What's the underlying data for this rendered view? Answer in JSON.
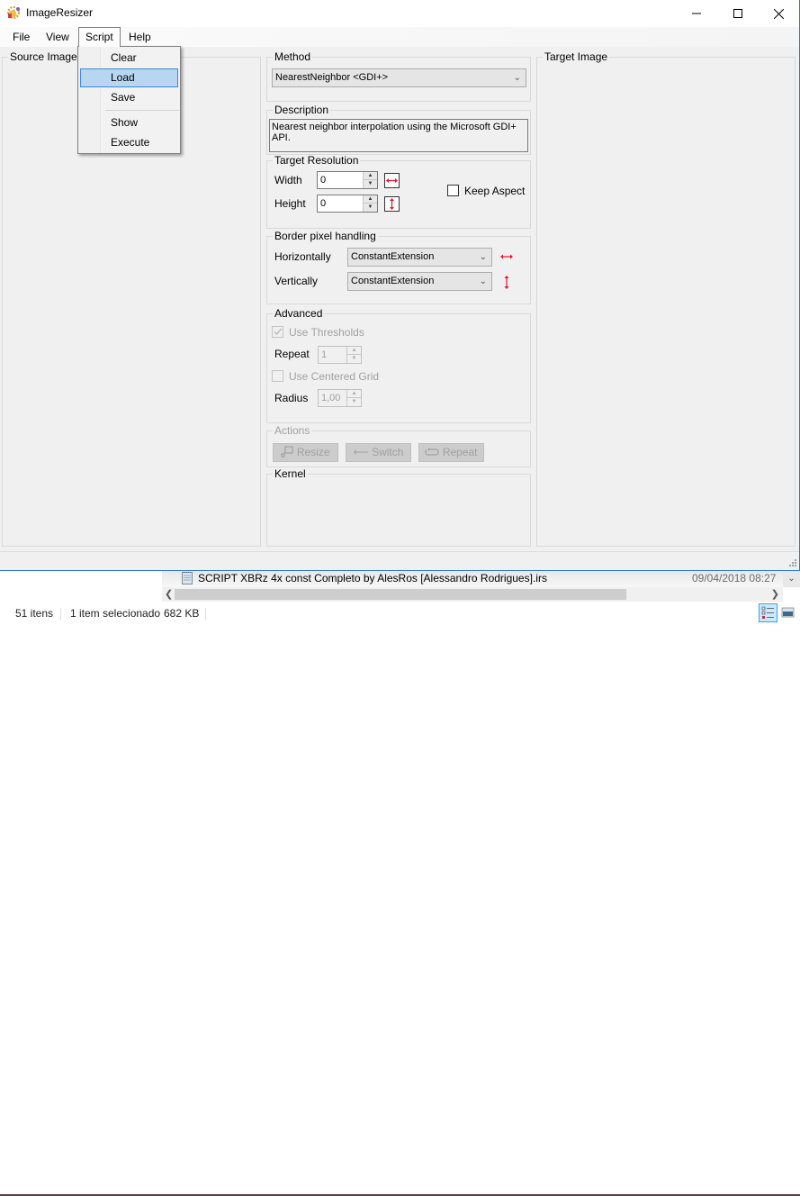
{
  "window": {
    "title": "ImageResizer",
    "controls": [
      "minimize",
      "maximize",
      "close"
    ]
  },
  "menubar": {
    "items": [
      {
        "label": "File"
      },
      {
        "label": "View"
      },
      {
        "label": "Script",
        "open": true
      },
      {
        "label": "Help"
      }
    ]
  },
  "script_menu": {
    "items": [
      {
        "label": "Clear",
        "selected": false
      },
      {
        "label": "Load",
        "selected": true
      },
      {
        "label": "Save",
        "selected": false
      },
      {
        "label": "Show",
        "selected": false
      },
      {
        "label": "Execute",
        "selected": false
      }
    ]
  },
  "source_image": {
    "label": "Source Image"
  },
  "target_image": {
    "label": "Target Image"
  },
  "method": {
    "label": "Method",
    "selected": "NearestNeighbor <GDI+>"
  },
  "description": {
    "label": "Description",
    "text": "Nearest neighbor interpolation using the Microsoft GDI+ API."
  },
  "target_resolution": {
    "label": "Target Resolution",
    "width_label": "Width",
    "width_value": "0",
    "height_label": "Height",
    "height_value": "0",
    "keep_aspect_label": "Keep Aspect",
    "keep_aspect_checked": false
  },
  "border_handling": {
    "label": "Border pixel handling",
    "horizontal_label": "Horizontally",
    "horizontal_value": "ConstantExtension",
    "vertical_label": "Vertically",
    "vertical_value": "ConstantExtension"
  },
  "advanced": {
    "label": "Advanced",
    "use_thresholds_label": "Use Thresholds",
    "use_thresholds_checked": true,
    "repeat_label": "Repeat",
    "repeat_value": "1",
    "use_centered_grid_label": "Use Centered Grid",
    "use_centered_grid_checked": false,
    "radius_label": "Radius",
    "radius_value": "1,00"
  },
  "actions": {
    "label": "Actions",
    "resize_label": "Resize",
    "switch_label": "Switch",
    "repeat_label": "Repeat"
  },
  "kernel": {
    "label": "Kernel"
  },
  "explorer": {
    "file_name": "SCRIPT XBRz 4x const Completo by AlesRos [Alessandro Rodrigues].irs",
    "file_date": "09/04/2018 08:27",
    "status_count": "51 itens",
    "status_selected": "1 item selecionado",
    "status_size": "682 KB"
  },
  "colors": {
    "menu_highlight": "#b6d6f2",
    "menu_highlight_border": "#3b8ad8",
    "arrow_icon": "#e81123",
    "window_border": "#2b79d0"
  }
}
